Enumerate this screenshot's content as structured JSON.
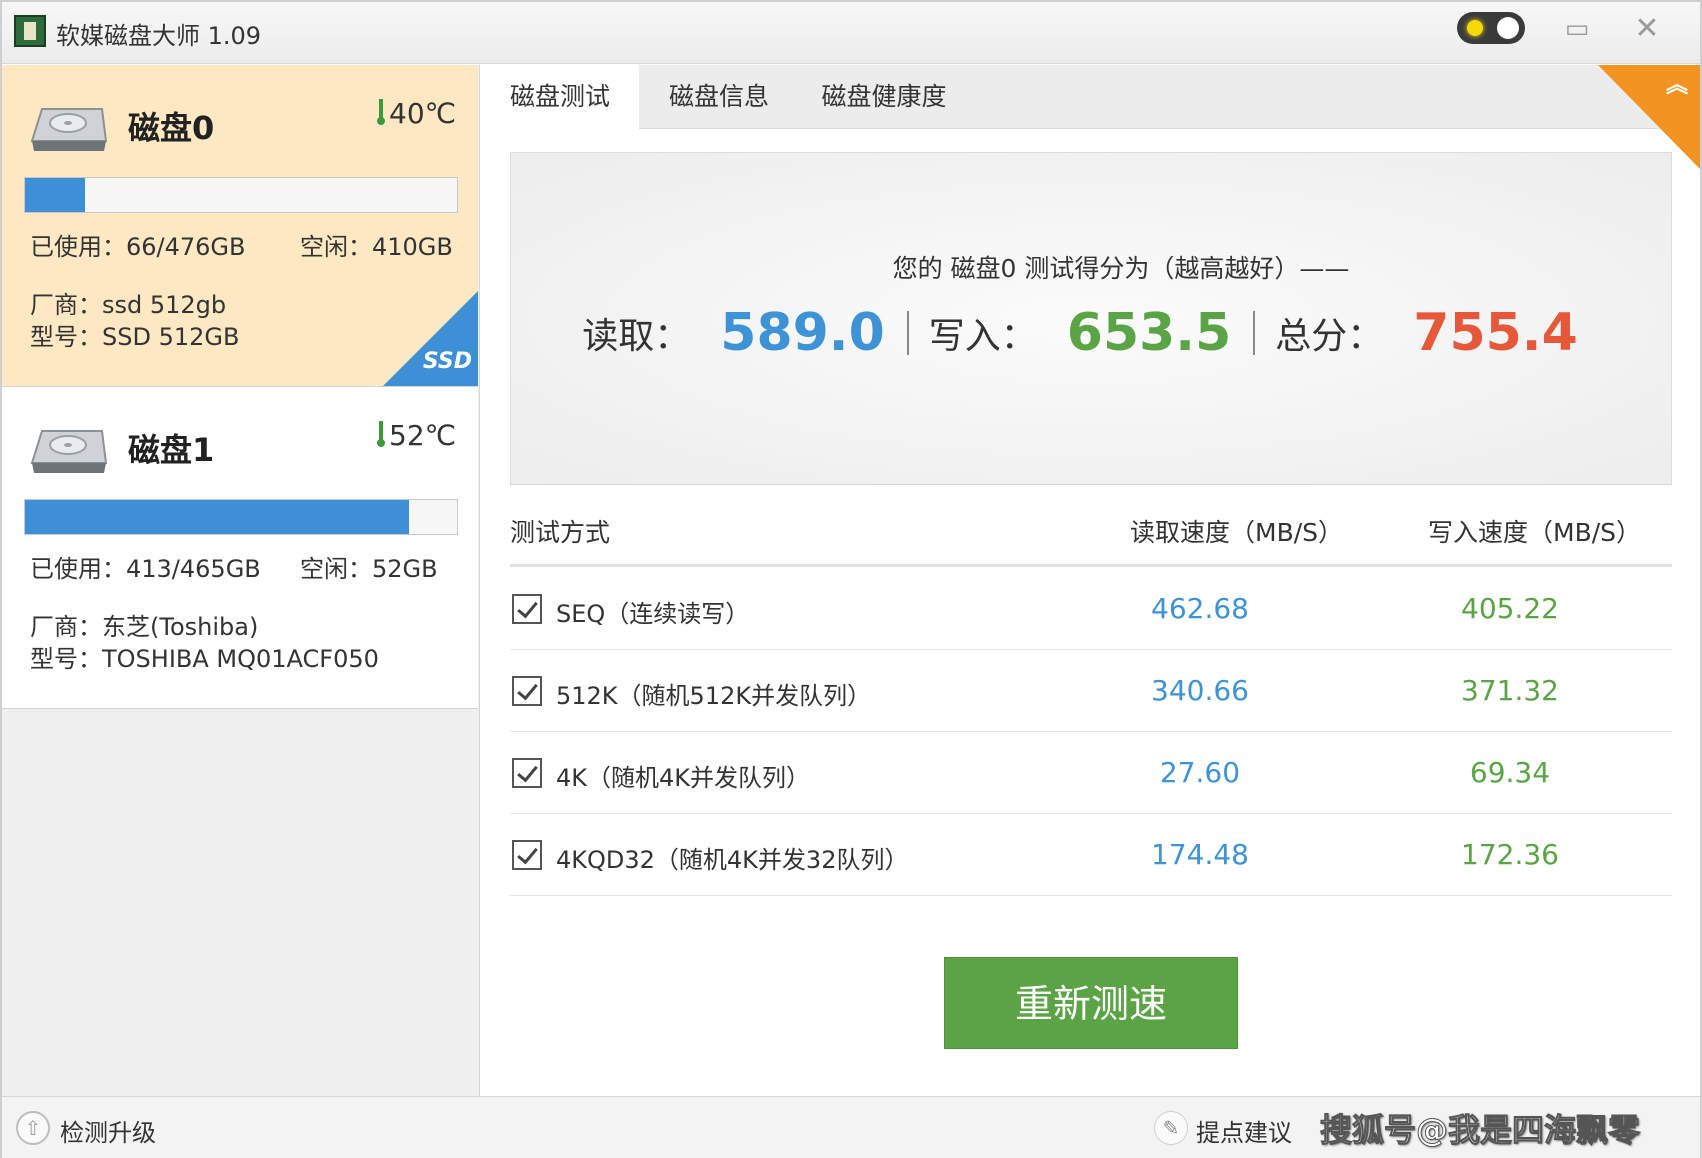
{
  "window": {
    "title": "软媒磁盘大师 1.09",
    "minimize_glyph": "▭",
    "close_glyph": "✕"
  },
  "disks": [
    {
      "name": "磁盘0",
      "temperature": "40℃",
      "used_fraction": 0.139,
      "used": "已使用：66/476GB",
      "free": "空闲：410GB",
      "vendor": "厂商：ssd 512gb",
      "model": "型号：SSD 512GB",
      "badge": "SSD",
      "selected": true
    },
    {
      "name": "磁盘1",
      "temperature": "52℃",
      "used_fraction": 0.888,
      "used": "已使用：413/465GB",
      "free": "空闲：52GB",
      "vendor": "厂商：东芝(Toshiba)",
      "model": "型号：TOSHIBA MQ01ACF050",
      "selected": false
    }
  ],
  "tabs": [
    "磁盘测试",
    "磁盘信息",
    "磁盘健康度"
  ],
  "active_tab": 0,
  "corner_glyph": "︽",
  "score": {
    "caption": "您的 磁盘0 测试得分为（越高越好）——",
    "read_label": "读取：",
    "read_value": "589.0",
    "write_label": "写入：",
    "write_value": "653.5",
    "total_label": "总分：",
    "total_value": "755.4"
  },
  "table": {
    "headers": {
      "method": "测试方式",
      "read": "读取速度（MB/S）",
      "write": "写入速度（MB/S）"
    },
    "rows": [
      {
        "label": "SEQ（连续读写）",
        "read": "462.68",
        "write": "405.22",
        "checked": true
      },
      {
        "label": "512K（随机512K并发队列）",
        "read": "340.66",
        "write": "371.32",
        "checked": true
      },
      {
        "label": "4K（随机4K并发队列）",
        "read": "27.60",
        "write": "69.34",
        "checked": true
      },
      {
        "label": "4KQD32（随机4K并发32队列）",
        "read": "174.48",
        "write": "172.36",
        "checked": true
      }
    ]
  },
  "retest_button": "重新测速",
  "footer": {
    "update_glyph": "⇧",
    "check_update": "检测升级",
    "feedback_glyph": "✎",
    "feedback": "提点建议",
    "watermark": "搜狐号@我是四海飘零"
  },
  "colors": {
    "selected_card": "#fde8c4",
    "usage_fill": "#3d8fd6",
    "read_blue": "#3d93d6",
    "write_green": "#5aa445",
    "total_red": "#e5583a",
    "button_green": "#5aa445",
    "corner_orange": "#f39322"
  }
}
